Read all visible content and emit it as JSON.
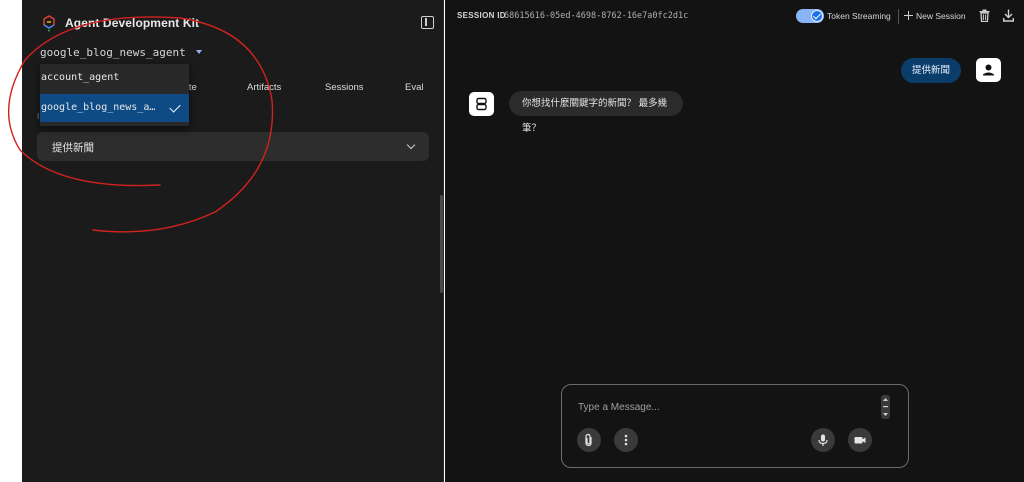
{
  "app": {
    "title": "Agent Development Kit",
    "brand_color": "#1a73e8"
  },
  "sidebar": {
    "agent_select": {
      "value": "google_blog_news_agent",
      "options": [
        "account_agent",
        "google_blog_news_a…"
      ],
      "selected_index": 1
    },
    "tabs": [
      {
        "label": "tate"
      },
      {
        "label": "Artifacts"
      },
      {
        "label": "Sessions"
      },
      {
        "label": "Eval"
      }
    ],
    "small_label": "I",
    "event_select_value": "提供新聞"
  },
  "session": {
    "label": "SESSION ID",
    "id": "68615616-05ed-4698-8762-16e7a0fc2d1c"
  },
  "toolbar": {
    "token_streaming_label": "Token Streaming",
    "token_streaming_on": true,
    "new_session_label": "New Session"
  },
  "chat": {
    "messages": [
      {
        "role": "user",
        "text": "提供新聞"
      },
      {
        "role": "bot",
        "text": "你想找什麼關鍵字的新聞？ 最多幾筆？"
      }
    ],
    "input_placeholder": "Type a Message...",
    "input_value": ""
  },
  "icons": {
    "logo": "adk-logo-icon",
    "collapse": "sidebar-collapse-icon",
    "trash": "trash-icon",
    "download": "download-icon",
    "attach": "paperclip-icon",
    "more": "more-vert-icon",
    "mic": "mic-icon",
    "video": "videocam-icon"
  },
  "colors": {
    "sidebar_bg": "#1b1b1b",
    "main_bg": "#131314",
    "selected_option": "#0e4a84",
    "user_bubble": "#0b3d6b",
    "annotation": "#d0231e"
  }
}
